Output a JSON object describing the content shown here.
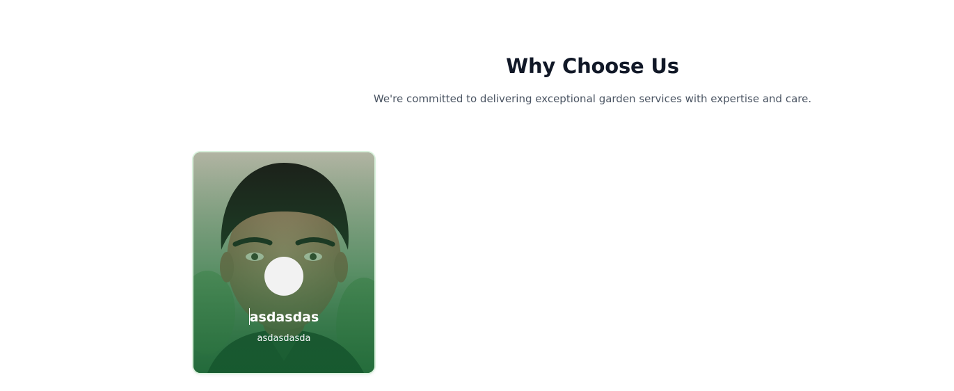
{
  "section": {
    "title": "Why Choose Us",
    "subtitle": "We're committed to delivering exceptional garden services with expertise and care."
  },
  "team_card": {
    "name": "asdasdas",
    "role": "asdasdasda",
    "photo_icon": "person-photo",
    "avatar_icon": "avatar-placeholder-icon"
  },
  "colors": {
    "heading": "#111827",
    "subtitle": "#4b5563",
    "card_overlay": "#1e783c",
    "card_border": "#d9f1dc"
  }
}
